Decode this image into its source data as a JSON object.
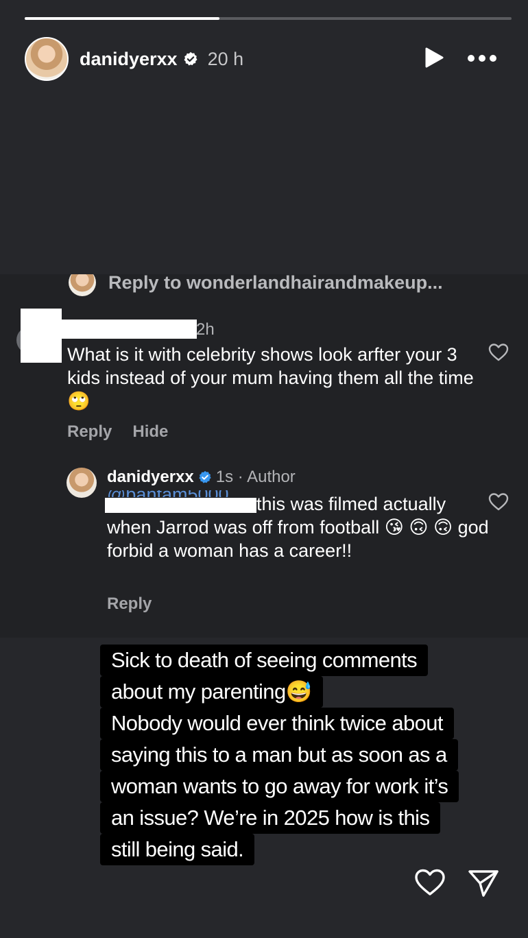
{
  "progress": {
    "segment_fraction": 0.4
  },
  "header": {
    "username": "danidyerxx",
    "time": "20 h",
    "icons": {
      "verified": "verified-badge-icon",
      "play": "play-icon",
      "more": "more-icon"
    }
  },
  "screenshot": {
    "reply_to": "Reply to wonderlandhairandmakeup...",
    "comment1": {
      "time": "2h",
      "text": "What is it with celebrity shows  look arfter your 3 kids instead of your mum having them all the time 🙄",
      "reply_label": "Reply",
      "hide_label": "Hide"
    },
    "comment2": {
      "username": "danidyerxx",
      "meta": "1s · Author",
      "mention_partial": "@bantam5000",
      "text": "this was filmed actually when Jarrod was off from football 😘 🙃 🙃 god forbid a woman has a career!!",
      "reply_label": "Reply"
    }
  },
  "caption": {
    "lines": [
      "Sick to death of seeing comments",
      "about my parenting😅",
      "Nobody would ever think twice about",
      "saying this to a man but as soon as a",
      "woman wants to go away for work it’s",
      "an issue? We’re in 2025 how is this",
      "still being said."
    ]
  },
  "footer": {
    "icons": {
      "like": "heart-icon",
      "send": "send-icon"
    }
  },
  "colors": {
    "background": "#26272b",
    "panel": "#212225",
    "text": "#ffffff",
    "muted": "#a4a5a9",
    "verified": "#3897f0"
  }
}
